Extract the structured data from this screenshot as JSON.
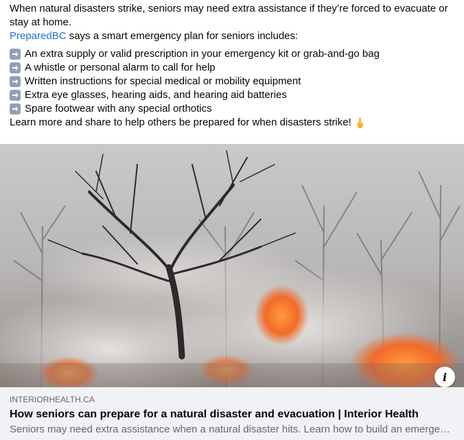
{
  "post": {
    "intro": "When natural disasters strike, seniors may need extra assistance if they’re forced to evacuate or stay at home.",
    "mention": "PreparedBC",
    "mention_suffix": " says a smart emergency plan for seniors includes:",
    "items": [
      "An extra supply or valid prescription in your emergency kit or grab-and-go bag",
      "A whistle or personal alarm to call for help",
      "Written instructions for special medical or mobility equipment",
      "Extra eye glasses, hearing aids, and hearing aid batteries",
      "Spare footwear with any special orthotics"
    ],
    "item_icon": "right-arrow-emoji",
    "outro": "Learn more and share to help others be prepared for when disasters strike!",
    "outro_icon": "backhand-index-pointing-down-emoji"
  },
  "link_preview": {
    "image_description": "wildfire-smoke-trees",
    "info_icon": "info-icon",
    "info_glyph": "i",
    "domain": "INTERIORHEALTH.CA",
    "title": "How seniors can prepare for a natural disaster and evacuation | Interior Health",
    "description": "Seniors may need extra assistance when a natural disaster hits. Learn how to build an emergency plan"
  },
  "colors": {
    "link": "#216fdb",
    "card_bg": "#f0f2f5",
    "muted_text": "#65676b",
    "fire": "#f26a2a"
  }
}
